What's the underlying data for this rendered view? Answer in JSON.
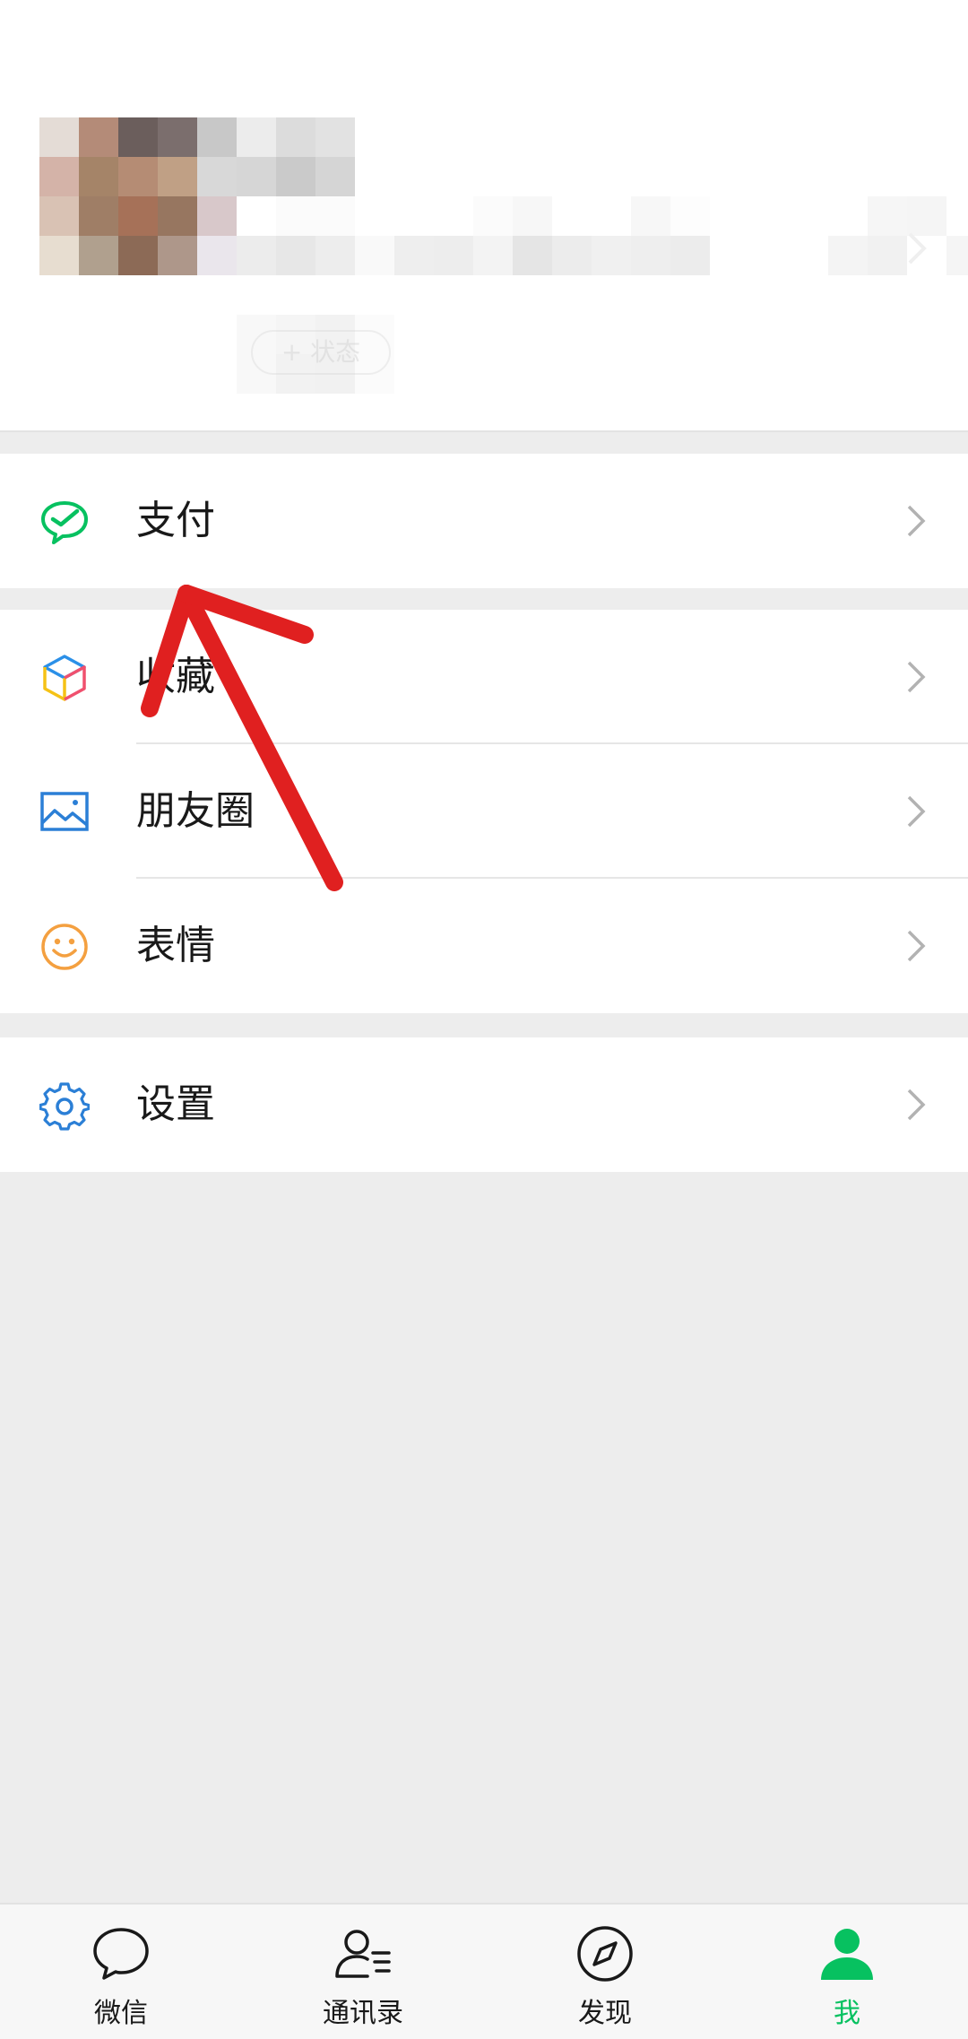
{
  "profile": {
    "avatar_mosaic": [
      "#e4dcd6",
      "#b48b78",
      "#6b5e5c",
      "#7b6e6d",
      "#c8c8c8",
      "#ececec",
      "#dcdcdc",
      "#e2e2e2",
      "#d4b3a8",
      "#a58468",
      "#b58c74",
      "#c0a085",
      "#d8d8d8",
      "#d6d6d6",
      "#cacaca",
      "#d5d5d5",
      "#d9c2b4",
      "#9f7e66",
      "#a67158",
      "#977660",
      "#d8c8ca",
      "#ffffff",
      "#f4f4f4",
      "#f3f3f3",
      "#e7ddd0",
      "#b0a08e",
      "#8c6a56",
      "#ae978a",
      "#eae6ec",
      "#ececec",
      "#e2e2e2",
      "#dedede"
    ],
    "name_mosaic": [
      "#ffffff",
      "#fbfbfb",
      "#fbfbfb",
      "#ffffff",
      "#ffffff",
      "#ffffff",
      "#fbfbfb",
      "#f7f7f7",
      "#ffffff",
      "#ffffff",
      "#f7f7f7",
      "#fdfdfd",
      "#ffffff",
      "#ffffff",
      "#ffffff",
      "#ffffff",
      "#f6f6f6",
      "#f5f5f5",
      "#ffffff",
      "#ececec",
      "#e7e7e7",
      "#ededed",
      "#f9f9f9",
      "#eeeeee",
      "#ededed",
      "#f3f3f3",
      "#e5e5e5",
      "#ececec",
      "#f0f0f0",
      "#eeeeee",
      "#ececec",
      "#ffffff",
      "#ffffff",
      "#ffffff",
      "#f4f4f4",
      "#f1f1f1",
      "#ffffff",
      "#f5f5f5"
    ],
    "status_mosaic": [
      "#f8f8f8",
      "#f5f5f5",
      "#f2f2f2",
      "#fbfbfb",
      "#f8f8f8",
      "#f2f2f2",
      "#f1f1f1",
      "#fbfbfb"
    ],
    "status_label": "+ 状态"
  },
  "menu": {
    "pay": "支付",
    "favorites": "收藏",
    "moments": "朋友圈",
    "stickers": "表情",
    "settings": "设置"
  },
  "tabs": [
    {
      "label": "微信",
      "icon": "chat-bubble-icon",
      "active": false
    },
    {
      "label": "通讯录",
      "icon": "contacts-icon",
      "active": false
    },
    {
      "label": "发现",
      "icon": "compass-icon",
      "active": false
    },
    {
      "label": "我",
      "icon": "person-icon",
      "active": true
    }
  ],
  "colors": {
    "accent_green": "#07c160",
    "annotation_red": "#e02020",
    "background": "#ededed",
    "chevron": "#b2b2b2"
  }
}
